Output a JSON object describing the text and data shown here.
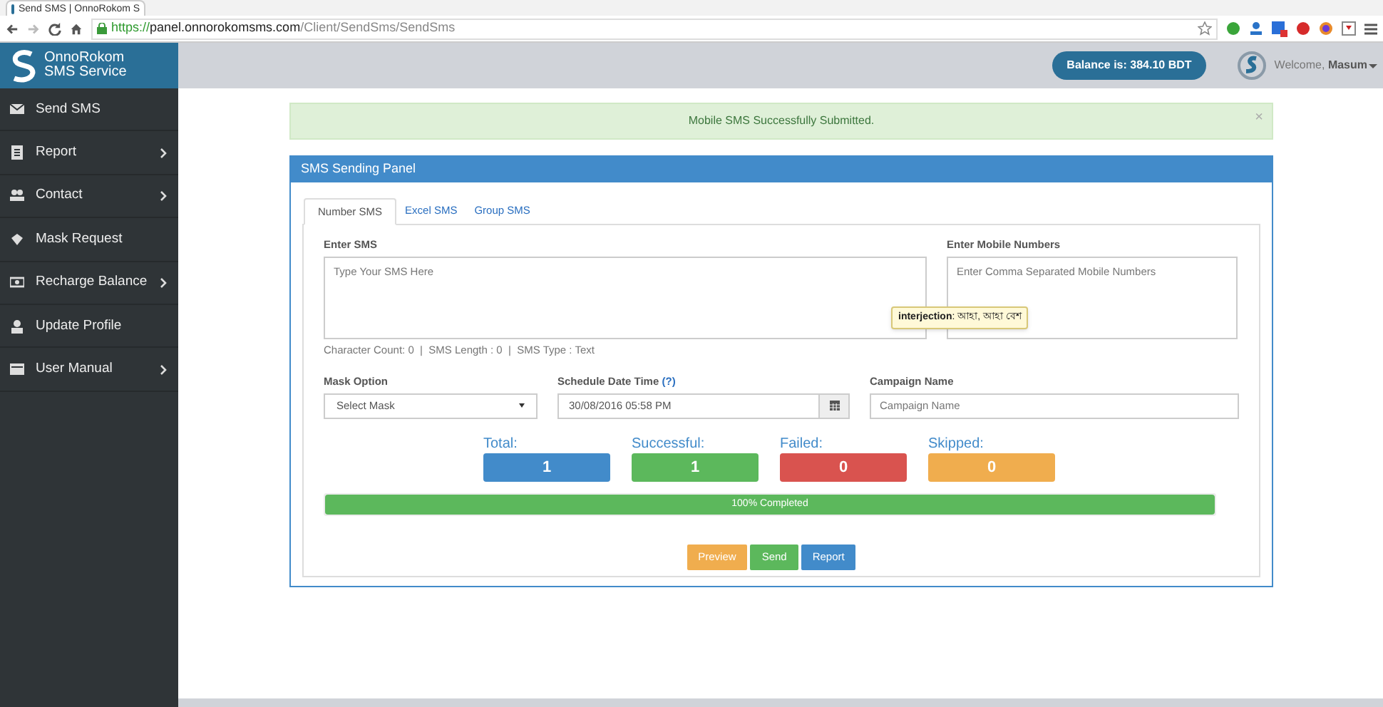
{
  "browser": {
    "tab_title": "Send SMS | OnnoRokom S",
    "url": {
      "scheme": "https://",
      "host": "panel.onnorokomsms.com",
      "path": "/Client/SendSms/SendSms"
    }
  },
  "brand": {
    "line1": "OnnoRokom",
    "line2": "SMS Service"
  },
  "header": {
    "balance": "Balance is: 384.10 BDT",
    "welcome": "Welcome,",
    "user": "Masum"
  },
  "sidebar": {
    "items": [
      {
        "label": "Send SMS",
        "submenu": false
      },
      {
        "label": "Report",
        "submenu": true
      },
      {
        "label": "Contact",
        "submenu": true
      },
      {
        "label": "Mask Request",
        "submenu": false
      },
      {
        "label": "Recharge Balance",
        "submenu": true
      },
      {
        "label": "Update Profile",
        "submenu": false
      },
      {
        "label": "User Manual",
        "submenu": true
      }
    ]
  },
  "alert": {
    "message": "Mobile SMS Successfully Submitted.",
    "close": "×"
  },
  "panel": {
    "title": "SMS Sending Panel",
    "tabs": [
      {
        "label": "Number SMS",
        "selected": true
      },
      {
        "label": "Excel SMS",
        "selected": false
      },
      {
        "label": "Group SMS",
        "selected": false
      }
    ],
    "sms": {
      "label": "Enter SMS",
      "placeholder": "Type Your SMS Here"
    },
    "numbers": {
      "label": "Enter Mobile Numbers",
      "placeholder": "Enter Comma Separated Mobile Numbers"
    },
    "counts": "Character Count: 0  |  SMS Length : 0  |  SMS Type : Text",
    "mask": {
      "label": "Mask Option",
      "value": "Select Mask"
    },
    "schedule": {
      "label": "Schedule Date Time",
      "help": "(?)",
      "value": "30/08/2016 05:58 PM"
    },
    "campaign": {
      "label": "Campaign Name",
      "placeholder": "Campaign Name"
    },
    "stats": [
      {
        "label": "Total:",
        "value": "1",
        "color": "#428bca"
      },
      {
        "label": "Successful:",
        "value": "1",
        "color": "#5cb85c"
      },
      {
        "label": "Failed:",
        "value": "0",
        "color": "#d9534f"
      },
      {
        "label": "Skipped:",
        "value": "0",
        "color": "#f0ad4e"
      }
    ],
    "progress": {
      "level": 1,
      "label": "100% Completed"
    },
    "buttons": [
      {
        "label": "Preview",
        "kind": "warning"
      },
      {
        "label": "Send",
        "kind": "success"
      },
      {
        "label": "Report",
        "kind": "primary"
      }
    ]
  },
  "tooltip": {
    "term": "interjection",
    "definition": ": আহা, আহা বেশ"
  }
}
